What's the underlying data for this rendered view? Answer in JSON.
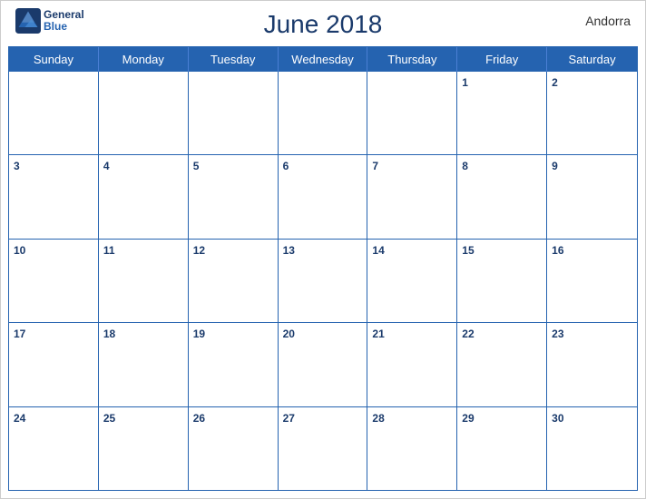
{
  "header": {
    "title": "June 2018",
    "country": "Andorra",
    "logo": {
      "line1": "General",
      "line2": "Blue"
    }
  },
  "days": {
    "headers": [
      "Sunday",
      "Monday",
      "Tuesday",
      "Wednesday",
      "Thursday",
      "Friday",
      "Saturday"
    ]
  },
  "weeks": [
    [
      {
        "date": "",
        "empty": true
      },
      {
        "date": "",
        "empty": true
      },
      {
        "date": "",
        "empty": true
      },
      {
        "date": "",
        "empty": true
      },
      {
        "date": "",
        "empty": true
      },
      {
        "date": "1"
      },
      {
        "date": "2"
      }
    ],
    [
      {
        "date": "3"
      },
      {
        "date": "4"
      },
      {
        "date": "5"
      },
      {
        "date": "6"
      },
      {
        "date": "7"
      },
      {
        "date": "8"
      },
      {
        "date": "9"
      }
    ],
    [
      {
        "date": "10"
      },
      {
        "date": "11"
      },
      {
        "date": "12"
      },
      {
        "date": "13"
      },
      {
        "date": "14"
      },
      {
        "date": "15"
      },
      {
        "date": "16"
      }
    ],
    [
      {
        "date": "17"
      },
      {
        "date": "18"
      },
      {
        "date": "19"
      },
      {
        "date": "20"
      },
      {
        "date": "21"
      },
      {
        "date": "22"
      },
      {
        "date": "23"
      }
    ],
    [
      {
        "date": "24"
      },
      {
        "date": "25"
      },
      {
        "date": "26"
      },
      {
        "date": "27"
      },
      {
        "date": "28"
      },
      {
        "date": "29"
      },
      {
        "date": "30"
      }
    ]
  ]
}
